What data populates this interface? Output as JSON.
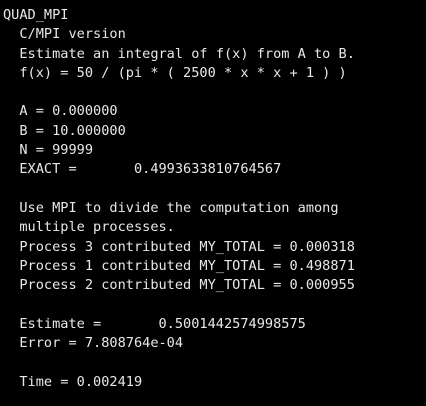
{
  "colors": {
    "background": "#000000",
    "foreground": "#e8e8e8"
  },
  "terminal": {
    "lines": [
      "QUAD_MPI",
      "  C/MPI version",
      "  Estimate an integral of f(x) from A to B.",
      "  f(x) = 50 / (pi * ( 2500 * x * x + 1 ) )",
      "",
      "  A = 0.000000",
      "  B = 10.000000",
      "  N = 99999",
      "  EXACT =       0.4993633810764567",
      "",
      "  Use MPI to divide the computation among",
      "  multiple processes.",
      "  Process 3 contributed MY_TOTAL = 0.000318",
      "  Process 1 contributed MY_TOTAL = 0.498871",
      "  Process 2 contributed MY_TOTAL = 0.000955",
      "",
      "  Estimate =       0.5001442574998575",
      "  Error = 7.808764e-04",
      "",
      "  Time = 0.002419"
    ]
  }
}
